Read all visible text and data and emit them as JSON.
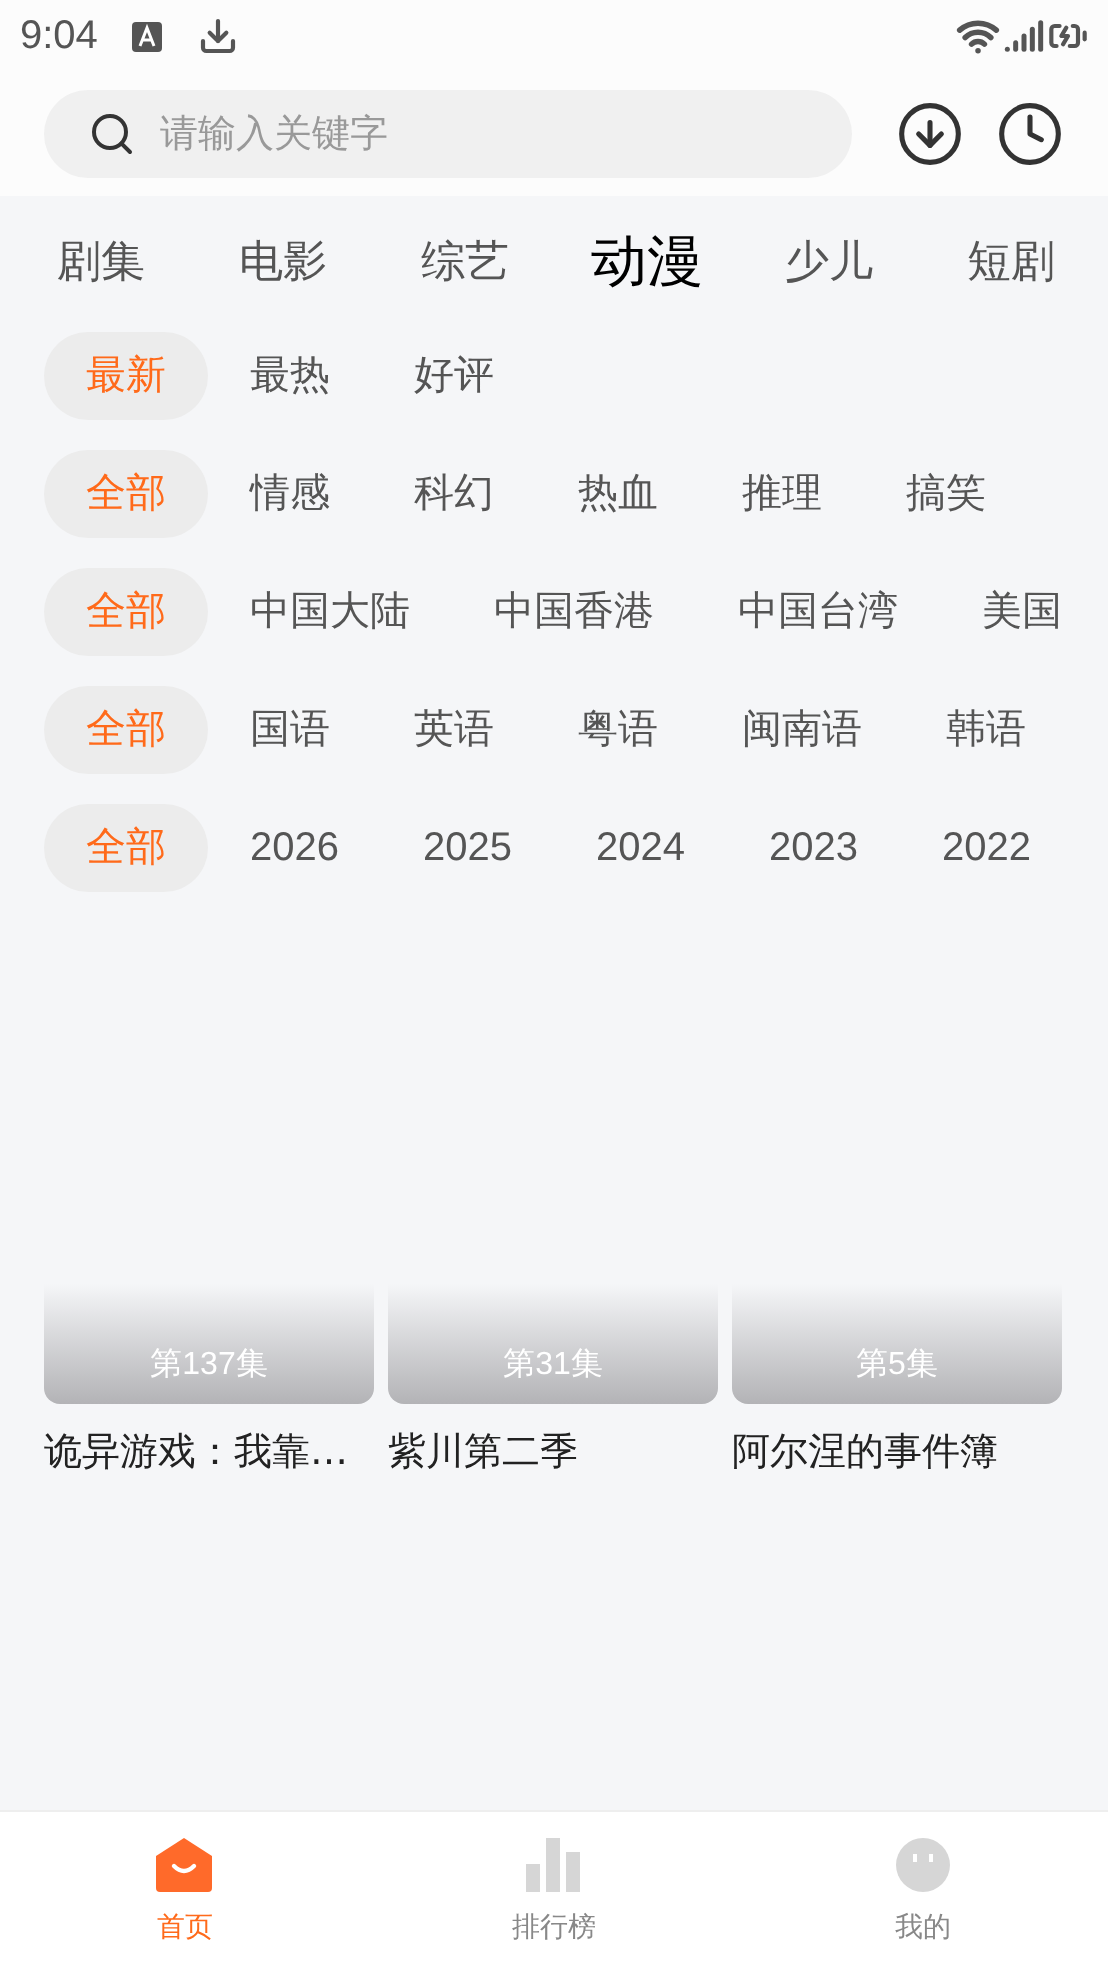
{
  "status_bar": {
    "time": "9:04"
  },
  "search": {
    "placeholder": "请输入关键字"
  },
  "categories": [
    {
      "label": "剧集",
      "selected": false
    },
    {
      "label": "电影",
      "selected": false
    },
    {
      "label": "综艺",
      "selected": false
    },
    {
      "label": "动漫",
      "selected": true
    },
    {
      "label": "少儿",
      "selected": false
    },
    {
      "label": "短剧",
      "selected": false
    }
  ],
  "filters": [
    {
      "options": [
        {
          "label": "最新",
          "selected": true
        },
        {
          "label": "最热",
          "selected": false
        },
        {
          "label": "好评",
          "selected": false
        }
      ]
    },
    {
      "options": [
        {
          "label": "全部",
          "selected": true
        },
        {
          "label": "情感",
          "selected": false
        },
        {
          "label": "科幻",
          "selected": false
        },
        {
          "label": "热血",
          "selected": false
        },
        {
          "label": "推理",
          "selected": false
        },
        {
          "label": "搞笑",
          "selected": false
        }
      ]
    },
    {
      "options": [
        {
          "label": "全部",
          "selected": true
        },
        {
          "label": "中国大陆",
          "selected": false
        },
        {
          "label": "中国香港",
          "selected": false
        },
        {
          "label": "中国台湾",
          "selected": false
        },
        {
          "label": "美国",
          "selected": false
        }
      ]
    },
    {
      "options": [
        {
          "label": "全部",
          "selected": true
        },
        {
          "label": "国语",
          "selected": false
        },
        {
          "label": "英语",
          "selected": false
        },
        {
          "label": "粤语",
          "selected": false
        },
        {
          "label": "闽南语",
          "selected": false
        },
        {
          "label": "韩语",
          "selected": false
        }
      ]
    },
    {
      "options": [
        {
          "label": "全部",
          "selected": true
        },
        {
          "label": "2026",
          "selected": false
        },
        {
          "label": "2025",
          "selected": false
        },
        {
          "label": "2024",
          "selected": false
        },
        {
          "label": "2023",
          "selected": false
        },
        {
          "label": "2022",
          "selected": false
        }
      ]
    }
  ],
  "videos": [
    {
      "episode": "第137集",
      "title": "诡异游戏：我靠…"
    },
    {
      "episode": "第31集",
      "title": "紫川第二季"
    },
    {
      "episode": "第5集",
      "title": "阿尔涅的事件簿"
    }
  ],
  "bottom_nav": [
    {
      "label": "首页",
      "selected": true
    },
    {
      "label": "排行榜",
      "selected": false
    },
    {
      "label": "我的",
      "selected": false
    }
  ]
}
